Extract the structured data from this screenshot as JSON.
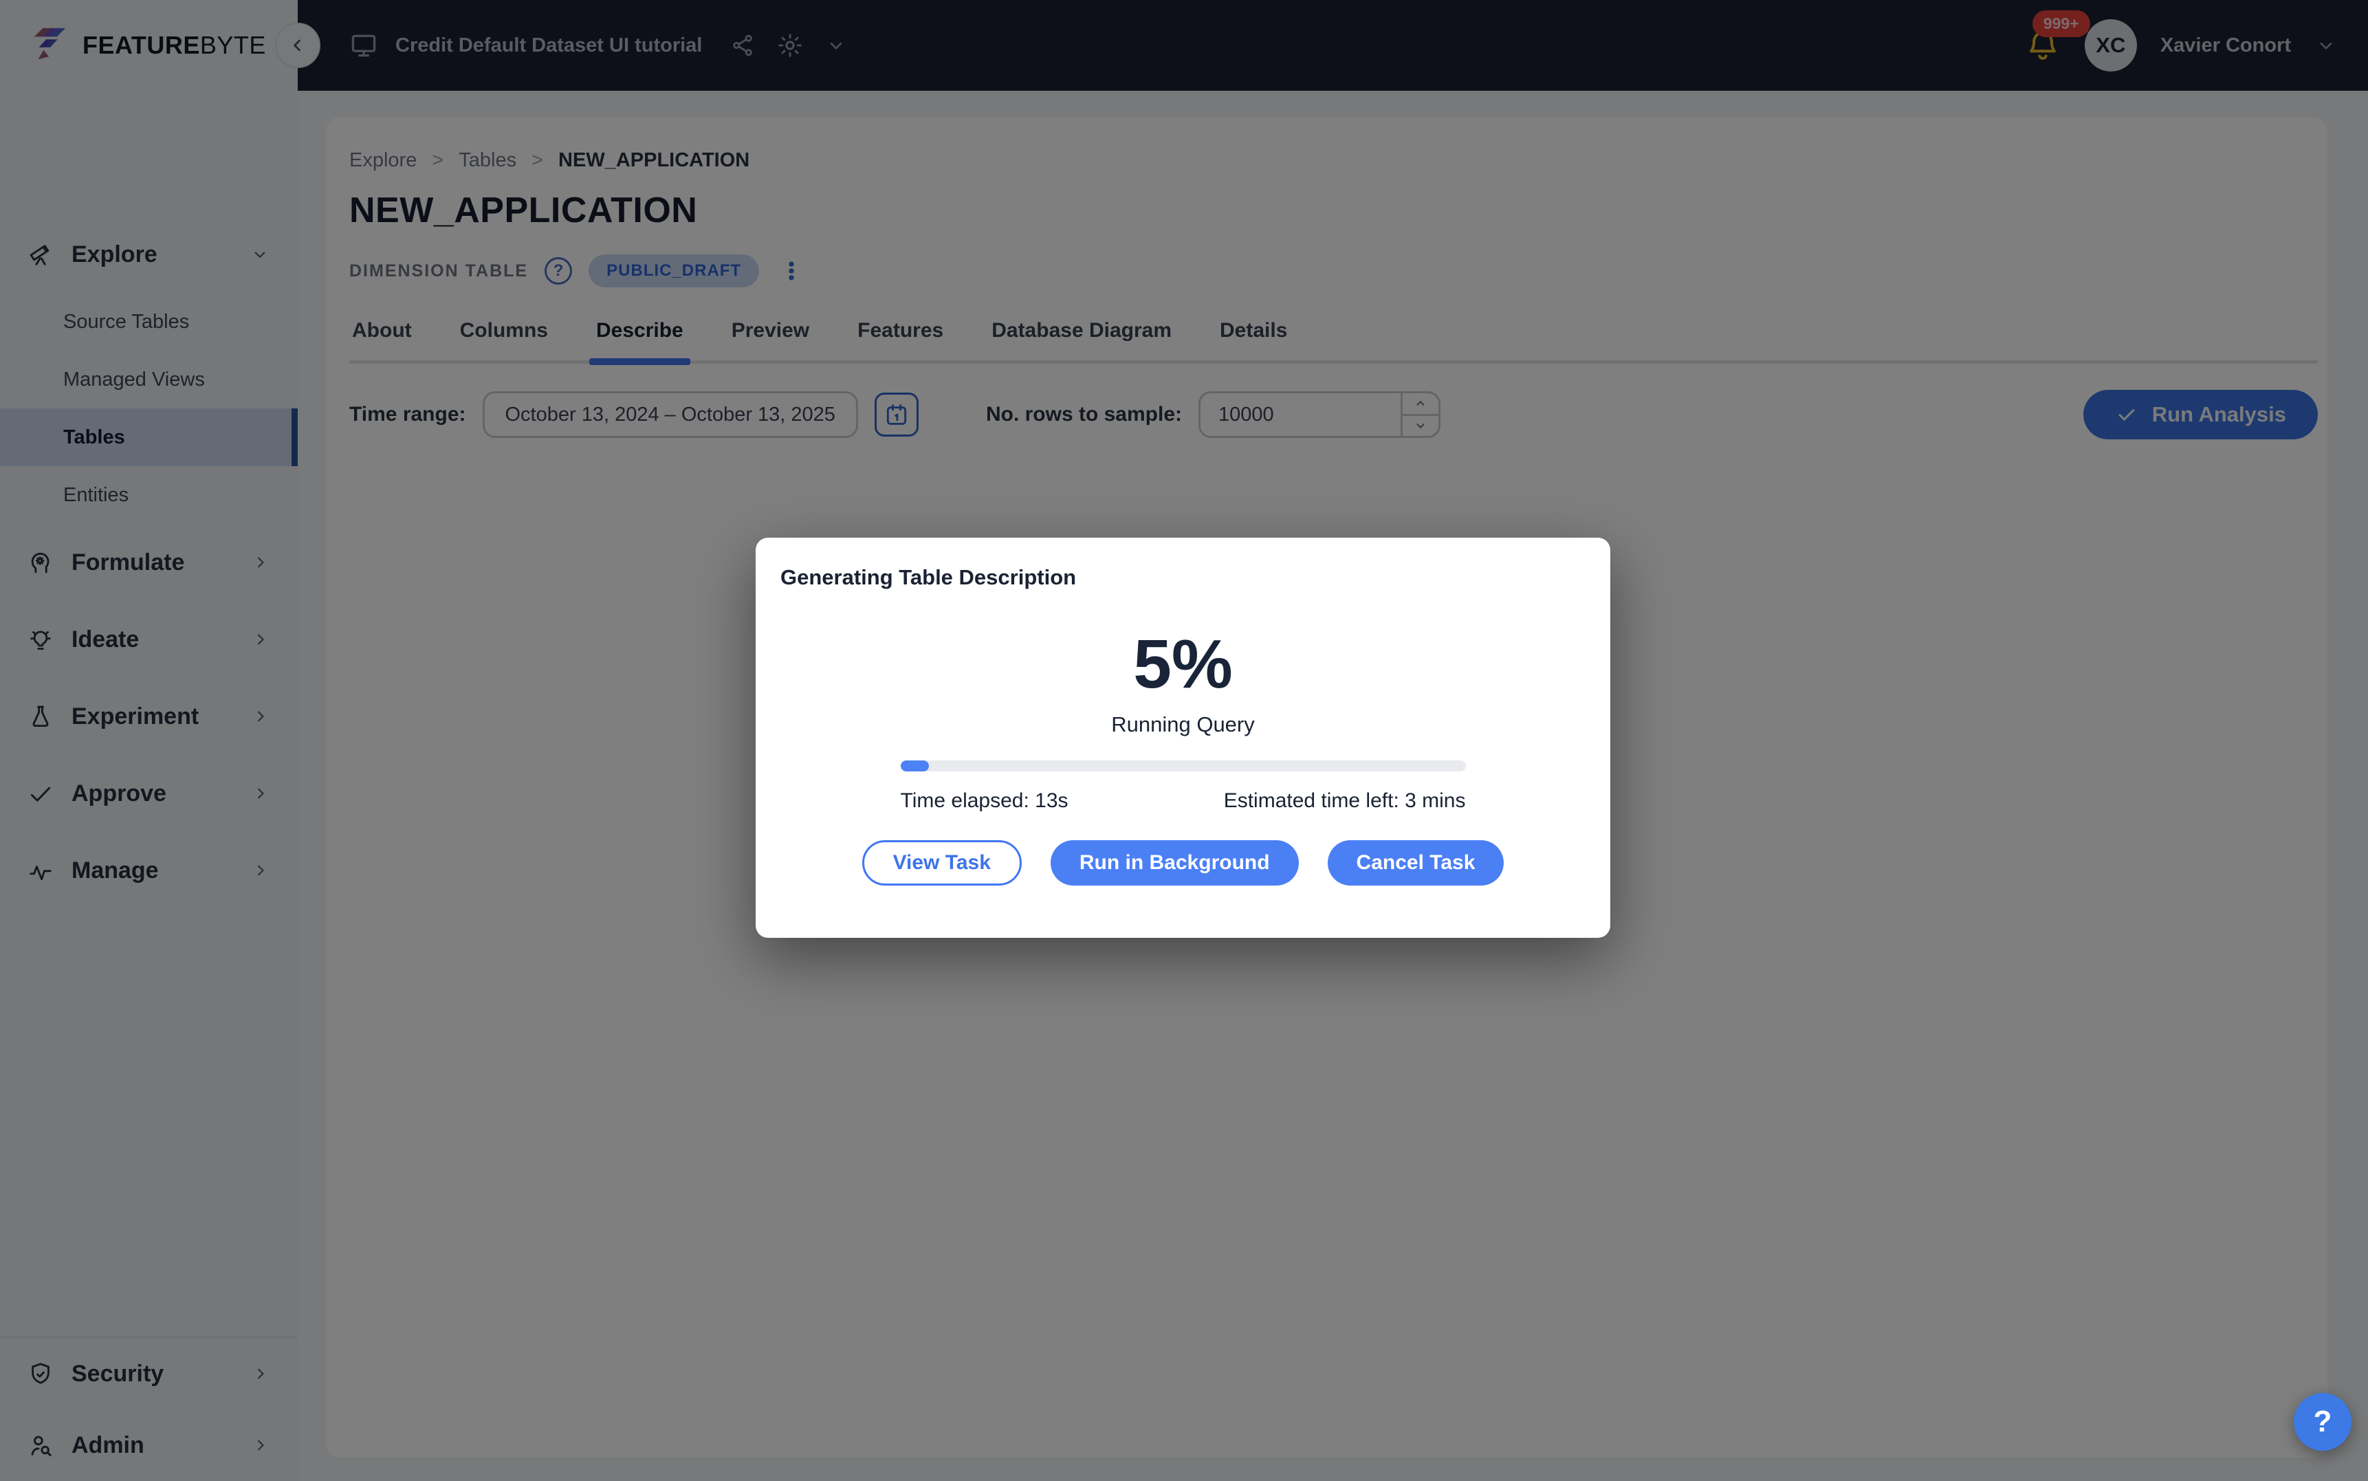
{
  "brand": {
    "logo_text_bold": "FEATURE",
    "logo_text_light": "BYTE"
  },
  "topbar": {
    "project_title": "Credit Default Dataset UI tutorial",
    "notification_count": "999+",
    "avatar_initials": "XC",
    "user_name": "Xavier Conort"
  },
  "sidebar": {
    "sections": [
      {
        "label": "Explore",
        "children": [
          {
            "label": "Source Tables"
          },
          {
            "label": "Managed Views"
          },
          {
            "label": "Tables",
            "active": true
          },
          {
            "label": "Entities"
          }
        ]
      },
      {
        "label": "Formulate"
      },
      {
        "label": "Ideate"
      },
      {
        "label": "Experiment"
      },
      {
        "label": "Approve"
      },
      {
        "label": "Manage"
      }
    ],
    "footer_sections": [
      {
        "label": "Security"
      },
      {
        "label": "Admin"
      }
    ]
  },
  "breadcrumb": {
    "separator": ">",
    "items": [
      "Explore",
      "Tables",
      "NEW_APPLICATION"
    ]
  },
  "page": {
    "title": "NEW_APPLICATION",
    "type_label": "DIMENSION TABLE",
    "help_glyph": "?",
    "status_badge": "PUBLIC_DRAFT"
  },
  "tabs": {
    "items": [
      "About",
      "Columns",
      "Describe",
      "Preview",
      "Features",
      "Database Diagram",
      "Details"
    ],
    "active": "Describe"
  },
  "controls": {
    "time_range_label": "Time range:",
    "time_range_value": "October 13, 2024 – October 13, 2025",
    "rows_label": "No. rows to sample:",
    "rows_value": "10000",
    "run_button_label": "Run Analysis"
  },
  "modal": {
    "title": "Generating Table Description",
    "progress_percent": "5%",
    "progress_value": 5,
    "progress_style": "width:5%",
    "status": "Running Query",
    "time_elapsed": "Time elapsed: 13s",
    "time_left": "Estimated time left: 3 mins",
    "buttons": {
      "view": "View Task",
      "background": "Run in Background",
      "cancel": "Cancel Task"
    }
  },
  "help": {
    "button_label": "?"
  },
  "colors": {
    "accent": "#4077F3",
    "topbar_bg": "#1B2130",
    "selected_nav_bg": "#C9D6EC",
    "badge_red": "#E8403A",
    "bell_gold": "#E8B62C",
    "draft_badge_bg": "#C7D6F1",
    "draft_badge_text": "#2F63D4"
  }
}
